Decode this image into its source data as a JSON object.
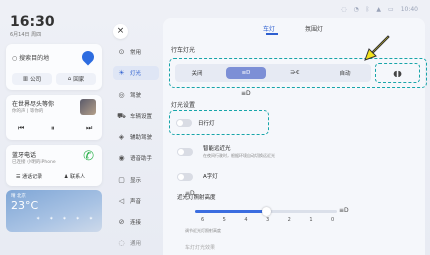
{
  "status": {
    "icons": [
      "signal-icon",
      "wifi-icon",
      "bluetooth-icon",
      "network-icon",
      "battery-icon"
    ],
    "time": "10:40"
  },
  "left": {
    "clock": "16:30",
    "date": "6月14日 周四",
    "nav": {
      "search": "搜索目的地",
      "home": "公司",
      "office": "回家"
    },
    "music": {
      "title": "在世界尽头等你",
      "sub": "你的声 | 等你的",
      "prev": "⏮",
      "play": "⏸",
      "next": "⏭"
    },
    "phone": {
      "title": "蓝牙电话",
      "sub": "已连接 小明的iPhone",
      "recent": "通话记录",
      "contacts": "联系人"
    },
    "weather": {
      "loc": "晴 北京",
      "temp": "23°C",
      "days": [
        "今天",
        "明天",
        "周六",
        "周日",
        "周一"
      ]
    }
  },
  "menu": {
    "close": "×",
    "items": [
      {
        "icon": "⊙",
        "label": "常用"
      },
      {
        "icon": "☀",
        "label": "灯光"
      },
      {
        "icon": "◎",
        "label": "驾驶"
      },
      {
        "icon": "⛟",
        "label": "车辆设置"
      },
      {
        "icon": "◈",
        "label": "辅助驾驶"
      },
      {
        "icon": "◉",
        "label": "语音助手"
      },
      {
        "icon": "▢",
        "label": "显示"
      },
      {
        "icon": "◁",
        "label": "声音"
      },
      {
        "icon": "⊘",
        "label": "连接"
      },
      {
        "icon": "◌",
        "label": "通用"
      }
    ]
  },
  "main": {
    "tabs": [
      "车灯",
      "氛围灯"
    ],
    "section_headlights": "行车灯光",
    "segments": [
      "关闭",
      "≡D",
      "⋺€",
      "自动"
    ],
    "extra_icon": "◖◗",
    "lowbeam_icon": "≡D",
    "section_settings": "灯光设置",
    "settings": [
      {
        "label": "日行灯",
        "desc": ""
      },
      {
        "label": "智能远近光",
        "desc": "在夜间行驶时，根据环境自动切换远近光"
      },
      {
        "label": "A字灯",
        "desc": ""
      }
    ],
    "height_title": "近光灯照射高度",
    "height_ticks": [
      "6",
      "5",
      "4",
      "3",
      "2",
      "1",
      "0"
    ],
    "height_hint": "调节近光灯照射高度",
    "height_left_icon": "≡D",
    "height_right_icon": "≡D",
    "more": "车灯灯光效果"
  },
  "accent": "#2d5fd0",
  "highlight_color": "#17a5a9",
  "arrow_color": "#f3e31c"
}
